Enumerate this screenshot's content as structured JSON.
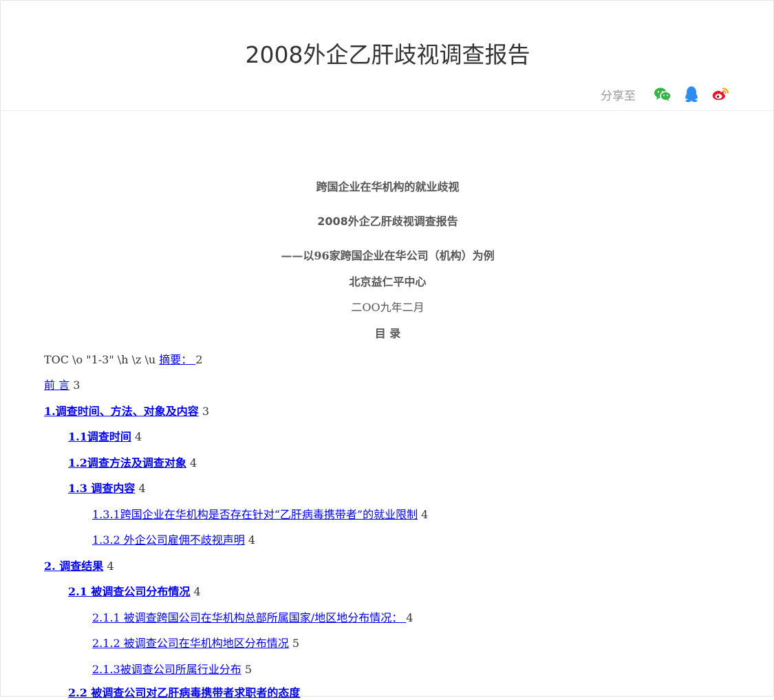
{
  "header": {
    "title": "2008外企乙肝歧视调查报告",
    "share_label": "分享至",
    "share_icons": [
      "wechat-icon",
      "qq-icon",
      "weibo-icon"
    ],
    "colors": {
      "wechat": "#39b24a",
      "qq": "#2d8cf0",
      "weibo": "#e6162d"
    }
  },
  "doc": {
    "line1": "跨国企业在华机构的就业歧视",
    "line2": "2008外企乙肝歧视调查报告",
    "line3": "——以96家跨国企业在华公司（机构）为例",
    "line4": "北京益仁平中心",
    "line5": "二OO九年二月",
    "line6": "目  录",
    "toc_prefix": "TOC \\o \"1-3\" \\h \\z \\u ",
    "toc": [
      {
        "text": "摘要： ",
        "page": "2"
      },
      {
        "text": "前    言",
        "page": "3"
      },
      {
        "text": "1.调查时间、方法、对象及内容",
        "page": "3"
      },
      {
        "text": "1.1调查时间",
        "page": "4"
      },
      {
        "text": "1.2调查方法及调查对象",
        "page": "4"
      },
      {
        "text": "1.3 调查内容",
        "page": "4"
      },
      {
        "text": "1.3.1跨国企业在华机构是否存在针对“乙肝病毒携带者”的就业限制",
        "page": "4"
      },
      {
        "text": "1.3.2 外企公司雇佣不歧视声明",
        "page": "4"
      },
      {
        "text": "2. 调查结果",
        "page": "4"
      },
      {
        "text": "2.1 被调查公司分布情况",
        "page": "4"
      },
      {
        "text": "2.1.1 被调查跨国公司在华机构总部所属国家/地区地分布情况： ",
        "page": "4"
      },
      {
        "text": "2.1.2 被调查公司在华机构地区分布情况",
        "page": "5"
      },
      {
        "text": "2.1.3被调查公司所属行业分布",
        "page": "5"
      },
      {
        "text": "2.2 被调查公司对乙肝病毒携带者求职者的态度",
        "page": ""
      }
    ]
  }
}
